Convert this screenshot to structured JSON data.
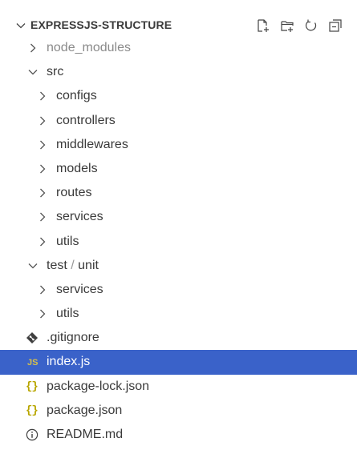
{
  "explorer": {
    "title": "EXPRESSJS-STRUCTURE",
    "actions": [
      {
        "icon": "new-file-icon"
      },
      {
        "icon": "new-folder-icon"
      },
      {
        "icon": "refresh-icon"
      },
      {
        "icon": "collapse-all-icon"
      }
    ]
  },
  "tree": {
    "node_modules": "node_modules",
    "src": "src",
    "configs": "configs",
    "controllers": "controllers",
    "middlewares": "middlewares",
    "models": "models",
    "routes": "routes",
    "services": "services",
    "utils": "utils",
    "test": "test",
    "test_sep": "/",
    "unit": "unit",
    "test_services": "services",
    "test_utils": "utils",
    "gitignore": ".gitignore",
    "index": "index.js",
    "index_icon": "JS",
    "package_lock": "package-lock.json",
    "package": "package.json",
    "json_icon": "{}",
    "readme": "README.md"
  },
  "colors": {
    "selection": "#3a62c9",
    "json_icon": "#b8a600",
    "js_icon": "#d6c04a",
    "dim_text": "#8a8a8a"
  }
}
